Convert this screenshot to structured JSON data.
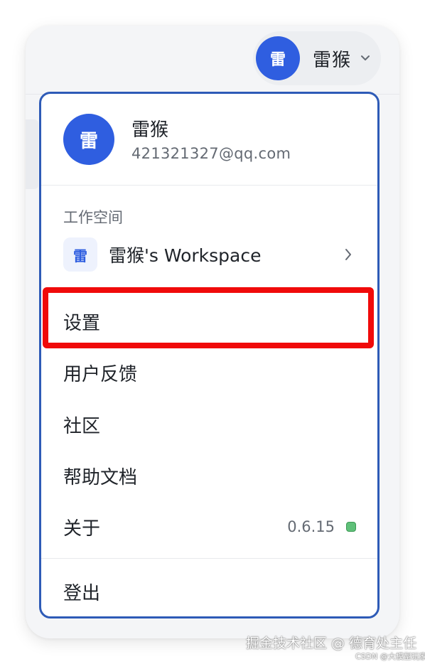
{
  "header": {
    "avatar_text": "雷",
    "user_name": "雷猴",
    "chevron_icon": "chevron-down-icon"
  },
  "profile": {
    "avatar_text": "雷",
    "name": "雷猴",
    "email": "421321327@qq.com"
  },
  "workspace": {
    "section_label": "工作空间",
    "icon_text": "雷",
    "name": "雷猴's Workspace",
    "chevron_icon": "chevron-right-icon"
  },
  "menu": {
    "settings": "设置",
    "feedback": "用户反馈",
    "community": "社区",
    "help_docs": "帮助文档",
    "about": "关于",
    "version": "0.6.15",
    "logout": "登出"
  },
  "colors": {
    "avatar": "#2f5ee0",
    "menu_border": "#2e5bb7",
    "highlight": "#f00a0a",
    "status_dot": "#5fc079"
  },
  "watermark": {
    "main": "掘金技术社区 @ 德育处主任",
    "sub": "CSDN @大模型玩家"
  }
}
